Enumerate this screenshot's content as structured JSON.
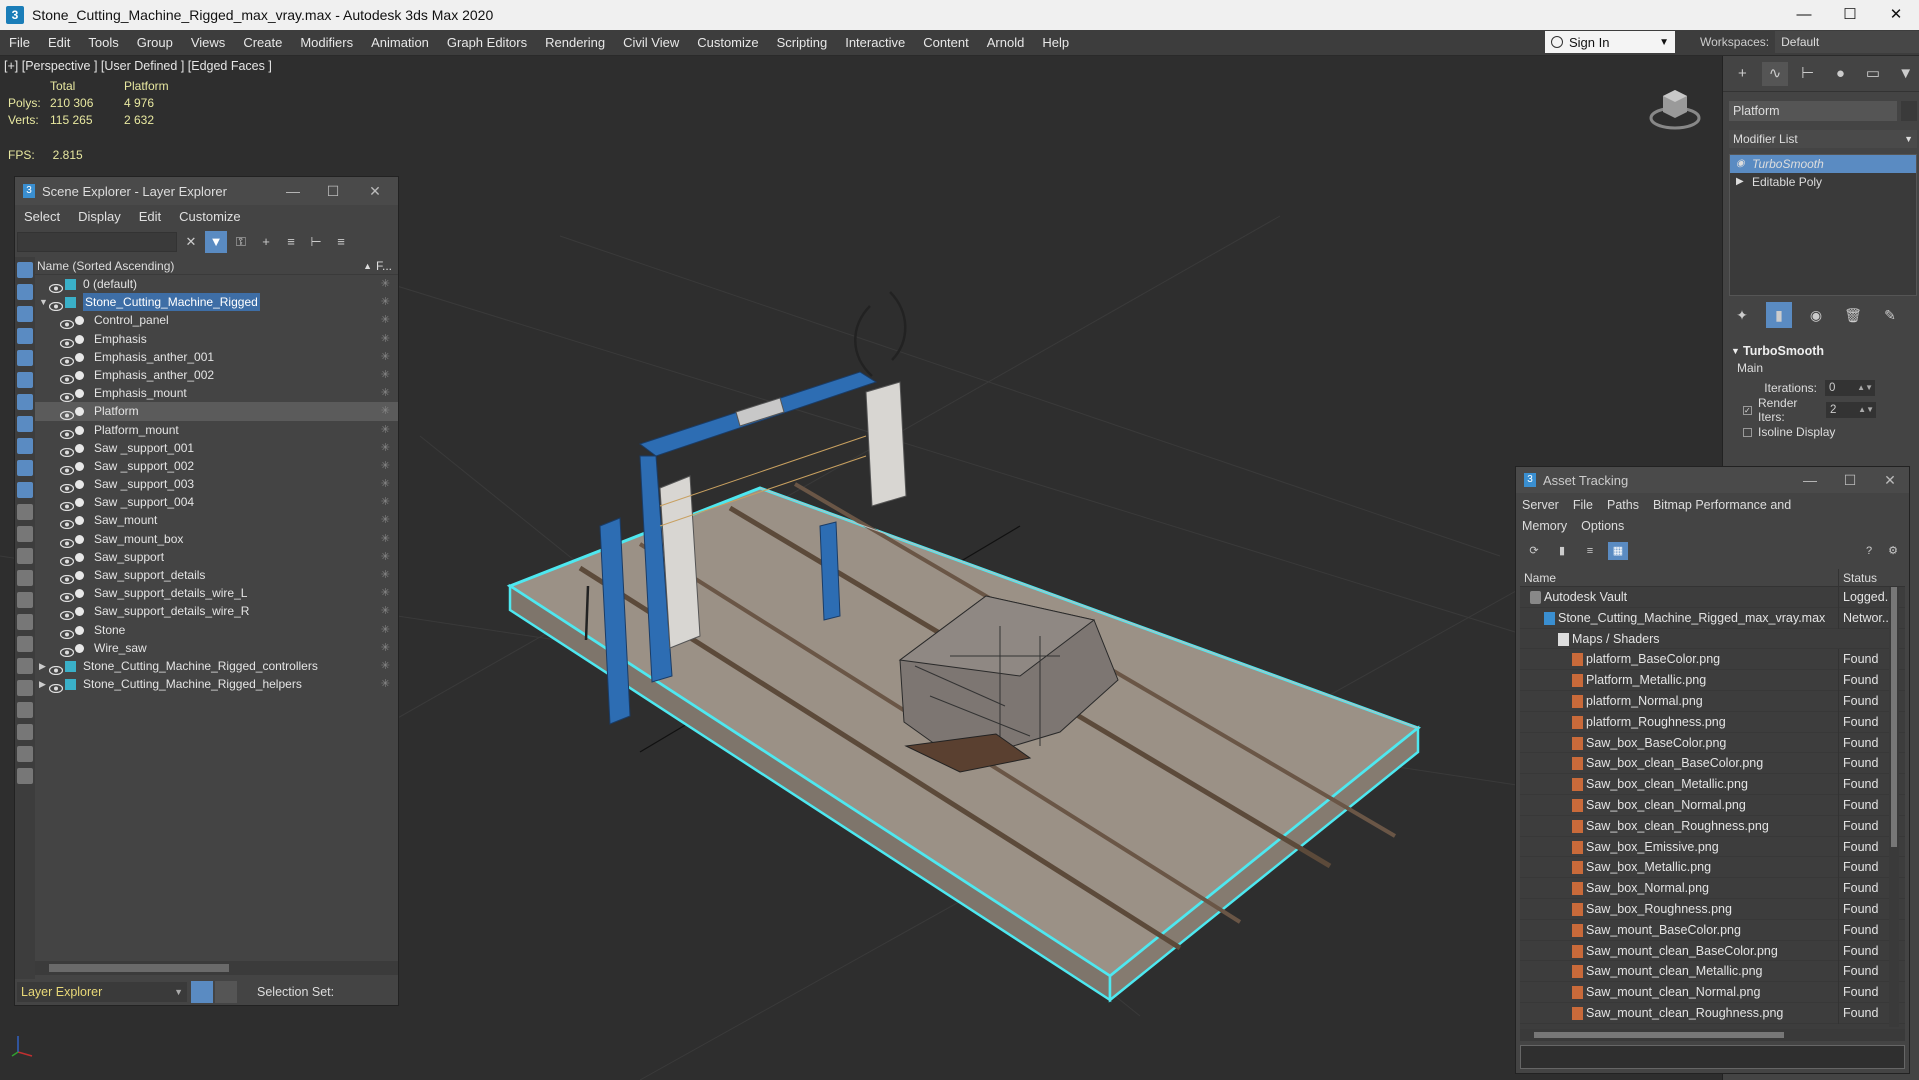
{
  "window": {
    "title": "Stone_Cutting_Machine_Rigged_max_vray.max - Autodesk 3ds Max 2020",
    "app_icon": "3"
  },
  "menubar": {
    "items": [
      "File",
      "Edit",
      "Tools",
      "Group",
      "Views",
      "Create",
      "Modifiers",
      "Animation",
      "Graph Editors",
      "Rendering",
      "Civil View",
      "Customize",
      "Scripting",
      "Interactive",
      "Content",
      "Arnold",
      "Help"
    ],
    "signin": "Sign In",
    "workspaces_label": "Workspaces:",
    "workspace_value": "Default"
  },
  "viewport": {
    "label": "[+] [Perspective ] [User Defined ] [Edged Faces ]",
    "stats": {
      "col_total": "Total",
      "col_selected": "Platform",
      "polys_label": "Polys:",
      "polys_total": "210 306",
      "polys_selected": "4 976",
      "verts_label": "Verts:",
      "verts_total": "115 265",
      "verts_selected": "2 632"
    },
    "fps_label": "FPS:",
    "fps_value": "2.815"
  },
  "scene_explorer": {
    "title": "Scene Explorer - Layer Explorer",
    "menu": [
      "Select",
      "Display",
      "Edit",
      "Customize"
    ],
    "header_name": "Name (Sorted Ascending)",
    "header_freeze": "F...",
    "rows": [
      {
        "label": "0 (default)",
        "level": 1,
        "type": "layer"
      },
      {
        "label": "Stone_Cutting_Machine_Rigged",
        "level": 1,
        "type": "layer",
        "expanded": true,
        "highlight": true
      },
      {
        "label": "Control_panel",
        "level": 2,
        "type": "object"
      },
      {
        "label": "Emphasis",
        "level": 2,
        "type": "object"
      },
      {
        "label": "Emphasis_anther_001",
        "level": 2,
        "type": "object"
      },
      {
        "label": "Emphasis_anther_002",
        "level": 2,
        "type": "object"
      },
      {
        "label": "Emphasis_mount",
        "level": 2,
        "type": "object"
      },
      {
        "label": "Platform",
        "level": 2,
        "type": "object",
        "selected": true
      },
      {
        "label": "Platform_mount",
        "level": 2,
        "type": "object"
      },
      {
        "label": "Saw _support_001",
        "level": 2,
        "type": "object"
      },
      {
        "label": "Saw _support_002",
        "level": 2,
        "type": "object"
      },
      {
        "label": "Saw _support_003",
        "level": 2,
        "type": "object"
      },
      {
        "label": "Saw _support_004",
        "level": 2,
        "type": "object"
      },
      {
        "label": "Saw_mount",
        "level": 2,
        "type": "object"
      },
      {
        "label": "Saw_mount_box",
        "level": 2,
        "type": "object"
      },
      {
        "label": "Saw_support",
        "level": 2,
        "type": "object"
      },
      {
        "label": "Saw_support_details",
        "level": 2,
        "type": "object"
      },
      {
        "label": "Saw_support_details_wire_L",
        "level": 2,
        "type": "object"
      },
      {
        "label": "Saw_support_details_wire_R",
        "level": 2,
        "type": "object"
      },
      {
        "label": "Stone",
        "level": 2,
        "type": "object"
      },
      {
        "label": "Wire_saw",
        "level": 2,
        "type": "object"
      },
      {
        "label": "Stone_Cutting_Machine_Rigged_controllers",
        "level": 1,
        "type": "layer",
        "collapsed": true
      },
      {
        "label": "Stone_Cutting_Machine_Rigged_helpers",
        "level": 1,
        "type": "layer",
        "collapsed": true
      }
    ],
    "layer_dropdown": "Layer Explorer",
    "selection_set_label": "Selection Set:"
  },
  "command_panel": {
    "object_name": "Platform",
    "modifier_list": "Modifier List",
    "stack": [
      {
        "label": "TurboSmooth",
        "selected": true
      },
      {
        "label": "Editable Poly",
        "selected": false
      }
    ],
    "rollout_title": "TurboSmooth",
    "rollout_sub": "Main",
    "iterations_label": "Iterations:",
    "iterations_value": "0",
    "render_iters_label": "Render Iters:",
    "render_iters_value": "2",
    "isoline_label": "Isoline Display"
  },
  "asset_tracking": {
    "title": "Asset Tracking",
    "menu": [
      "Server",
      "File",
      "Paths",
      "Bitmap Performance and Memory",
      "Options"
    ],
    "col_name": "Name",
    "col_status": "Status",
    "rows": [
      {
        "name": "Autodesk Vault",
        "status": "Logged...",
        "indent": 1,
        "icon": "vault"
      },
      {
        "name": "Stone_Cutting_Machine_Rigged_max_vray.max",
        "status": "Networ...",
        "indent": 2,
        "icon": "max"
      },
      {
        "name": "Maps / Shaders",
        "status": "",
        "indent": 3,
        "icon": "folder"
      },
      {
        "name": "platform_BaseColor.png",
        "status": "Found",
        "indent": 4,
        "icon": "png"
      },
      {
        "name": "Platform_Metallic.png",
        "status": "Found",
        "indent": 4,
        "icon": "png"
      },
      {
        "name": "platform_Normal.png",
        "status": "Found",
        "indent": 4,
        "icon": "png"
      },
      {
        "name": "platform_Roughness.png",
        "status": "Found",
        "indent": 4,
        "icon": "png"
      },
      {
        "name": "Saw_box_BaseColor.png",
        "status": "Found",
        "indent": 4,
        "icon": "png"
      },
      {
        "name": "Saw_box_clean_BaseColor.png",
        "status": "Found",
        "indent": 4,
        "icon": "png"
      },
      {
        "name": "Saw_box_clean_Metallic.png",
        "status": "Found",
        "indent": 4,
        "icon": "png"
      },
      {
        "name": "Saw_box_clean_Normal.png",
        "status": "Found",
        "indent": 4,
        "icon": "png"
      },
      {
        "name": "Saw_box_clean_Roughness.png",
        "status": "Found",
        "indent": 4,
        "icon": "png"
      },
      {
        "name": "Saw_box_Emissive.png",
        "status": "Found",
        "indent": 4,
        "icon": "png"
      },
      {
        "name": "Saw_box_Metallic.png",
        "status": "Found",
        "indent": 4,
        "icon": "png"
      },
      {
        "name": "Saw_box_Normal.png",
        "status": "Found",
        "indent": 4,
        "icon": "png"
      },
      {
        "name": "Saw_box_Roughness.png",
        "status": "Found",
        "indent": 4,
        "icon": "png"
      },
      {
        "name": "Saw_mount_BaseColor.png",
        "status": "Found",
        "indent": 4,
        "icon": "png"
      },
      {
        "name": "Saw_mount_clean_BaseColor.png",
        "status": "Found",
        "indent": 4,
        "icon": "png"
      },
      {
        "name": "Saw_mount_clean_Metallic.png",
        "status": "Found",
        "indent": 4,
        "icon": "png"
      },
      {
        "name": "Saw_mount_clean_Normal.png",
        "status": "Found",
        "indent": 4,
        "icon": "png"
      },
      {
        "name": "Saw_mount_clean_Roughness.png",
        "status": "Found",
        "indent": 4,
        "icon": "png"
      }
    ]
  },
  "colors": {
    "accent": "#5a8bc2",
    "selection_outline": "#4ee8f0",
    "stats_text": "#e8e8a0",
    "machine_blue": "#2d6db3"
  }
}
